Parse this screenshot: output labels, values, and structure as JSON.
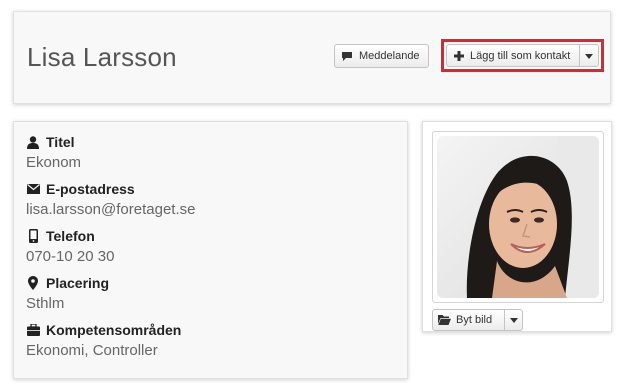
{
  "profile": {
    "name": "Lisa Larsson"
  },
  "actions": {
    "message_label": "Meddelande",
    "add_contact_label": "Lägg till som kontakt"
  },
  "fields": [
    {
      "icon": "user-icon",
      "label": "Titel",
      "value": "Ekonom"
    },
    {
      "icon": "envelope-icon",
      "label": "E-postadress",
      "value": "lisa.larsson@foretaget.se"
    },
    {
      "icon": "phone-icon",
      "label": "Telefon",
      "value": "070-10 20 30"
    },
    {
      "icon": "map-marker-icon",
      "label": "Placering",
      "value": "Sthlm"
    },
    {
      "icon": "briefcase-icon",
      "label": "Kompetensområden",
      "value": "Ekonomi, Controller"
    }
  ],
  "photo": {
    "change_label": "Byt bild"
  },
  "colors": {
    "highlight": "#e8222a",
    "card_bg": "#f8f8f8",
    "name": "#555555"
  }
}
